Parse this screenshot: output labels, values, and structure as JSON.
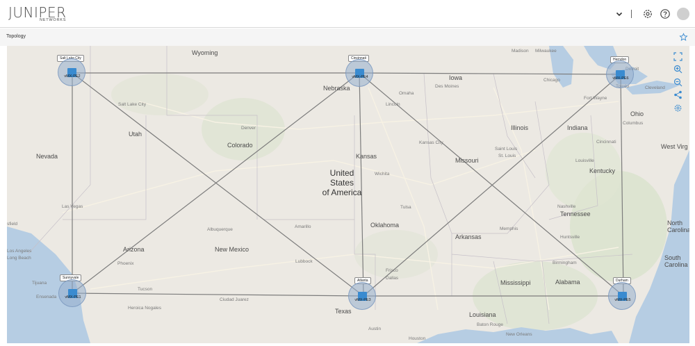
{
  "header": {
    "logo_main": "JUNIPER",
    "logo_sub": "NETWORKS",
    "icons": [
      "chevron-down-icon",
      "gear-icon",
      "help-icon",
      "avatar"
    ]
  },
  "page": {
    "title": "Topology"
  },
  "toolbar": {
    "icons": [
      "fit-to-screen-icon",
      "zoom-in-icon",
      "zoom-out-icon",
      "share-icon",
      "settings-icon"
    ]
  },
  "colors": {
    "map_background": "#ece9e3",
    "water": "#b6cde3",
    "link": "#7c7c7c",
    "node_fill": "#96afcd",
    "node_icon": "#3a8bd0"
  },
  "map": {
    "states": [
      "Wyoming",
      "Nebraska",
      "Iowa",
      "Utah",
      "Colorado",
      "Kansas",
      "Missouri",
      "Illinois",
      "Indiana",
      "Ohio",
      "Nevada",
      "West Virg",
      "Kentucky",
      "Oklahoma",
      "Arkansas",
      "Tennessee",
      "Arizona",
      "New Mexico",
      "Mississippi",
      "Alabama",
      "Texas",
      "Louisiana",
      "North Carolina",
      "South Carolina"
    ],
    "cities": [
      "Madison",
      "Milwaukee",
      "Detroit",
      "Chicago",
      "Toledo",
      "Cleveland",
      "Des Moines",
      "Omaha",
      "Lincoln",
      "Fort Wayne",
      "Columbus",
      "Salt Lake City",
      "Denver",
      "Cincinnati",
      "Kansas City",
      "Saint Louis",
      "St. Louis",
      "Louisville",
      "Wichita",
      "Las Vegas",
      "Nashville",
      "Tulsa",
      "Memphis",
      "Amarillo",
      "Albuquerque",
      "Huntsville",
      "Birmingham",
      "Phoenix",
      "Lubbock",
      "Frisco",
      "Dallas",
      "Tucson",
      "Tijuana",
      "Ensenada",
      "Heroica Nogales",
      "Ciudad Juarez",
      "Austin",
      "Baton Rouge",
      "Houston",
      "New Orleans",
      "Los Angeles",
      "Long Beach",
      "sfield"
    ],
    "country": "United\nStates\nof America"
  },
  "nodes": [
    {
      "id": "vMX-PE2",
      "tag": "Salt Lake City"
    },
    {
      "id": "vMX-PE4",
      "tag": "Cincinnati"
    },
    {
      "id": "vMX-PE6",
      "tag": "Herndon"
    },
    {
      "id": "vMX-PE1",
      "tag": "Sunnyvale"
    },
    {
      "id": "vMX-PE3",
      "tag": "Atlanta"
    },
    {
      "id": "vMX-PE5",
      "tag": "Durham"
    }
  ]
}
